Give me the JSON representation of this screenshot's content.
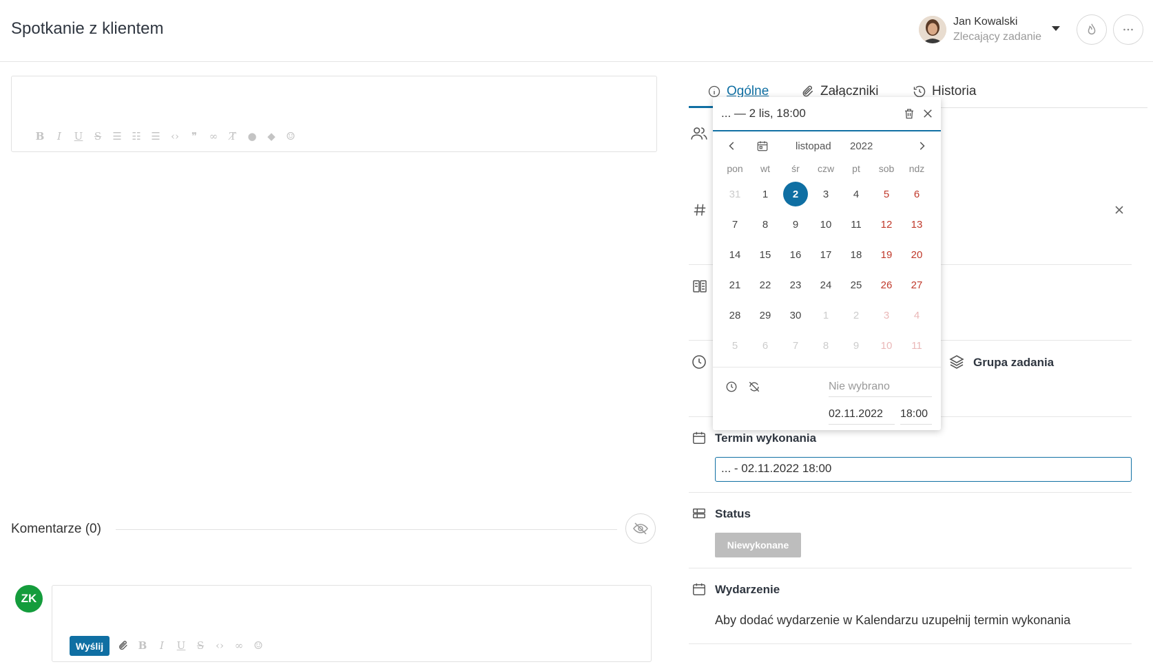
{
  "header": {
    "title": "Spotkanie z klientem",
    "user_name": "Jan Kowalski",
    "user_role": "Zlecający zadanie"
  },
  "comments": {
    "title": "Komentarze (0)",
    "avatar_initials": "ZK",
    "send_label": "Wyślij"
  },
  "tabs": [
    {
      "label": "Ogólne",
      "icon": "info-icon"
    },
    {
      "label": "Załączniki",
      "icon": "paperclip-icon"
    },
    {
      "label": "Historia",
      "icon": "history-icon"
    }
  ],
  "fields": {
    "task_group_label": "Grupa zadania",
    "deadline_label": "Termin wykonania",
    "deadline_value": "... - 02.11.2022 18:00",
    "status_label": "Status",
    "status_value": "Niewykonane",
    "event_label": "Wydarzenie",
    "event_text": "Aby dodać wydarzenie w Kalendarzu uzupełnij termin wykonania"
  },
  "date_picker": {
    "range_text": "... — 2 lis, 18:00",
    "month": "listopad",
    "year": "2022",
    "weekdays": [
      "pon",
      "wt",
      "śr",
      "czw",
      "pt",
      "sob",
      "ndz"
    ],
    "weeks": [
      [
        "31",
        "1",
        "2",
        "3",
        "4",
        "5",
        "6"
      ],
      [
        "7",
        "8",
        "9",
        "10",
        "11",
        "12",
        "13"
      ],
      [
        "14",
        "15",
        "16",
        "17",
        "18",
        "19",
        "20"
      ],
      [
        "21",
        "22",
        "23",
        "24",
        "25",
        "26",
        "27"
      ],
      [
        "28",
        "29",
        "30",
        "1",
        "2",
        "3",
        "4"
      ],
      [
        "5",
        "6",
        "7",
        "8",
        "9",
        "10",
        "11"
      ]
    ],
    "selected_day": "2",
    "start_placeholder": "Nie wybrano",
    "end_date": "02.11.2022",
    "end_time": "18:00"
  },
  "colors": {
    "accent": "#0f6fa3",
    "weekend": "#c0392b",
    "avatar_green": "#149c3c",
    "status_gray": "#bdbdbd"
  }
}
